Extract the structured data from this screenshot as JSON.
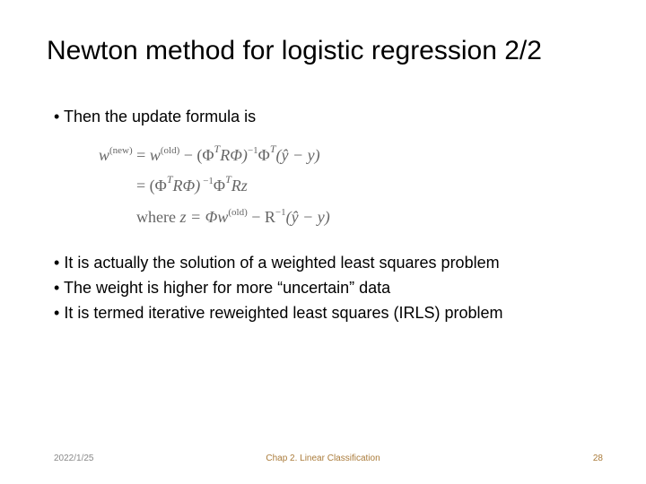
{
  "slide": {
    "title": "Newton method for logistic regression 2/2",
    "bullets": {
      "b1": "Then the update formula is",
      "b2": "It is actually the solution of a weighted least squares problem",
      "b3": "The weight is higher for more “uncertain” data",
      "b4": "It is termed iterative reweighted least squares (IRLS) problem"
    },
    "equations": {
      "line1_lhs": "w",
      "line1_new": "(new)",
      "line1_eq": " = ",
      "line1_w": "w",
      "line1_old": "(old)",
      "line1_rest_a": " − (Φ",
      "line1_T1": "T",
      "line1_R": "RΦ)",
      "line1_inv": "−1",
      "line1_phi": "Φ",
      "line1_T2": "T",
      "line1_tail": "(ŷ − y)",
      "line2_lead": "= (Φ",
      "line2_T1": "T",
      "line2_R": "RΦ)",
      "line2_inv": "−1",
      "line2_phi": "Φ",
      "line2_T2": "T",
      "line2_tail": "Rz",
      "line3_where": "where ",
      "line3_z": "z = Φw",
      "line3_old": "(old)",
      "line3_mid": " − R",
      "line3_inv": "−1",
      "line3_tail": "(ŷ − y)"
    }
  },
  "footer": {
    "date": "2022/1/25",
    "chapter": "Chap 2. Linear Classification",
    "page": "28"
  }
}
